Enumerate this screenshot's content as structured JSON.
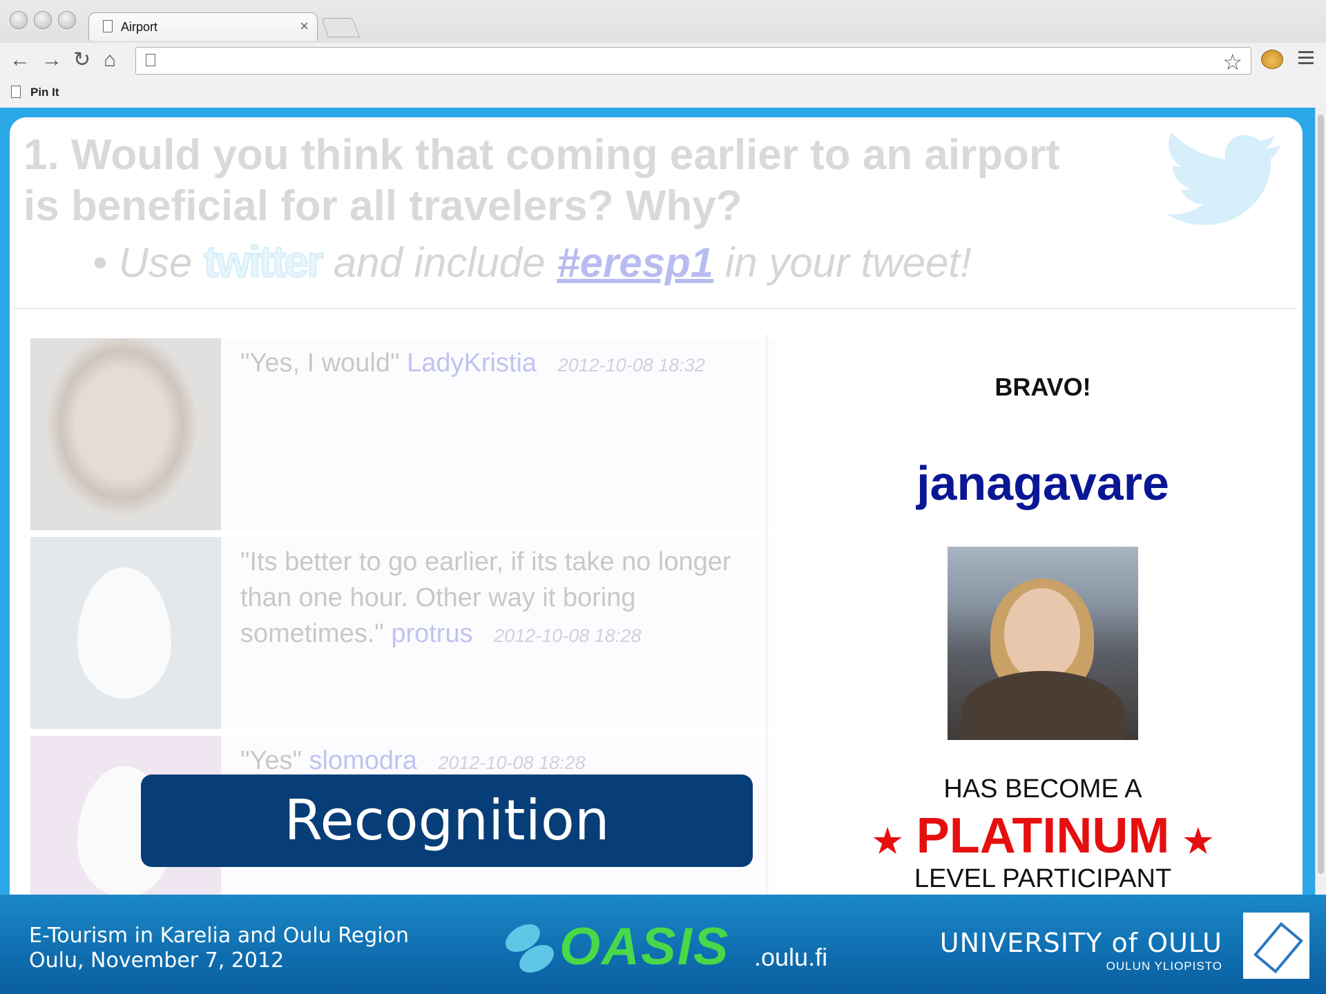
{
  "browser": {
    "tab_title": "Airport",
    "tab_close": "×",
    "bookmark": "Pin It"
  },
  "page": {
    "question_line1": "1. Would you think that coming earlier to an airport",
    "question_line2": "is beneficial for all travelers? Why?",
    "bullet_prefix": "• Use",
    "twitter_logo_text": "twitter",
    "bullet_middle": "and include",
    "hashtag": "#eresp1",
    "bullet_suffix": "in your tweet!"
  },
  "tweets": [
    {
      "text": "\"Yes, I would\"",
      "user": "LadyKristia",
      "time": "2012-10-08 18:32"
    },
    {
      "text": "\"Its better to go earlier, if its take no longer than one hour. Other way it boring sometimes.\"",
      "user": "protrus",
      "time": "2012-10-08 18:28"
    },
    {
      "text": "\"Yes\"",
      "user": "slomodra",
      "time": "2012-10-08 18:28"
    }
  ],
  "overlay_label": "Recognition",
  "award": {
    "bravo": "BRAVO!",
    "username": "janagavare",
    "became": "HAS BECOME A",
    "level_word": "PLATINUM",
    "star": "★",
    "level_suffix": "LEVEL PARTICIPANT"
  },
  "footer": {
    "line1": "E-Tourism in Karelia and Oulu Region",
    "line2": "Oulu, November 7, 2012",
    "oasis_word": "OASIS",
    "oasis_domain": ".oulu.fi",
    "university": "UNIVERSITY of OULU",
    "university_sub": "OULUN YLIOPISTO"
  },
  "colors": {
    "frame_blue": "#2aa7e6",
    "banner_navy": "#073e78",
    "username_blue": "#0a1794",
    "platinum_red": "#e50f0f",
    "oasis_green": "#49d84a"
  },
  "icons": [
    "back-arrow-icon",
    "forward-arrow-icon",
    "reload-icon",
    "home-icon",
    "page-icon",
    "bookmark-star-icon",
    "extension-icon",
    "menu-icon",
    "twitter-bird-icon"
  ]
}
